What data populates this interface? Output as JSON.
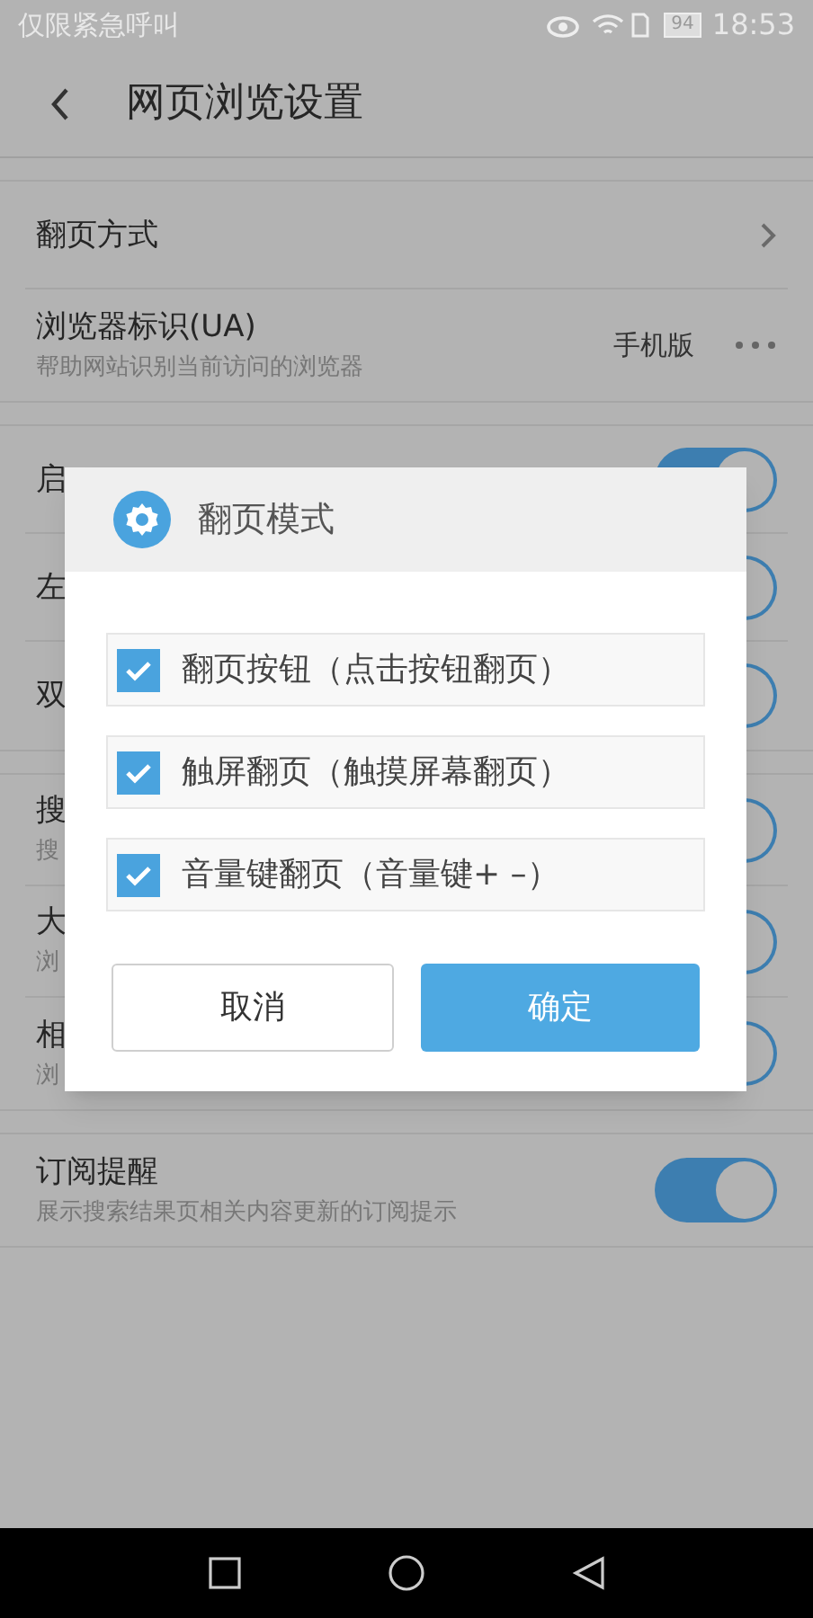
{
  "status_bar": {
    "carrier": "仅限紧急呼叫",
    "battery": "94",
    "time": "18:53"
  },
  "header": {
    "title": "网页浏览设置"
  },
  "sections": [
    {
      "rows": [
        {
          "kind": "link",
          "title": "翻页方式"
        },
        {
          "kind": "value",
          "title": "浏览器标识(UA)",
          "subtitle": "帮助网站识别当前访问的浏览器",
          "value": "手机版"
        }
      ]
    },
    {
      "rows": [
        {
          "kind": "toggle",
          "title": "启",
          "on": true
        },
        {
          "kind": "toggle",
          "title": "左",
          "on": true
        },
        {
          "kind": "toggle",
          "title": "双",
          "on": true
        }
      ]
    },
    {
      "rows": [
        {
          "kind": "toggle",
          "title": "搜",
          "subtitle": "搜",
          "on": true
        },
        {
          "kind": "toggle",
          "title": "大",
          "subtitle": "浏",
          "on": true
        },
        {
          "kind": "toggle",
          "title": "相",
          "subtitle": "浏",
          "on": true
        }
      ]
    },
    {
      "rows": [
        {
          "kind": "toggle",
          "title": "订阅提醒",
          "subtitle": "展示搜索结果页相关内容更新的订阅提示",
          "on": true
        }
      ]
    }
  ],
  "dialog": {
    "title": "翻页模式",
    "options": [
      {
        "label": "翻页按钮（点击按钮翻页）",
        "checked": true
      },
      {
        "label": "触屏翻页（触摸屏幕翻页）",
        "checked": true
      },
      {
        "label": "音量键翻页（音量键+ –）",
        "checked": true
      }
    ],
    "buttons": [
      {
        "label": "取消",
        "kind": "secondary"
      },
      {
        "label": "确定",
        "kind": "primary"
      }
    ]
  }
}
